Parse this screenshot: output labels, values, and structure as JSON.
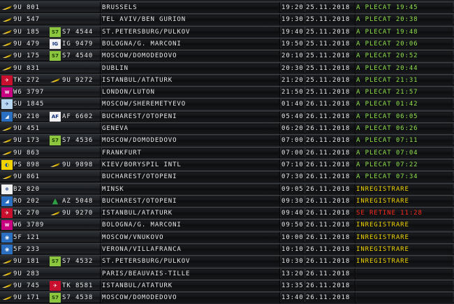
{
  "colors": {
    "green": "#8fe24a",
    "yellow": "#f2d600",
    "red": "#ff2a1a"
  },
  "rows": [
    {
      "logo": "wing",
      "flight": "9U 801",
      "code_logo": "",
      "code": "",
      "dest": "BRUSSELS",
      "time": "19:20",
      "date": "25.11.2018",
      "status": "A PLECAT 19:45",
      "status_type": "green"
    },
    {
      "logo": "wing",
      "flight": "9U 547",
      "code_logo": "",
      "code": "",
      "dest": "TEL AVIV/BEN GURION",
      "time": "19:30",
      "date": "25.11.2018",
      "status": "A PLECAT 20:38",
      "status_type": "green"
    },
    {
      "logo": "wing",
      "flight": "9U 185",
      "code_logo": "s7",
      "code": "S7 4544",
      "dest": "ST.PETERSBURG/PULKOV",
      "time": "19:40",
      "date": "25.11.2018",
      "status": "A PLECAT 19:48",
      "status_type": "green"
    },
    {
      "logo": "wing",
      "flight": "9U 479",
      "code_logo": "alitalia",
      "code": "IG 9479",
      "dest": "BOLOGNA/G. MARCONI",
      "time": "19:50",
      "date": "25.11.2018",
      "status": "A PLECAT 20:06",
      "status_type": "green"
    },
    {
      "logo": "wing",
      "flight": "9U 175",
      "code_logo": "s7",
      "code": "S7 4540",
      "dest": "MOSCOW/DOMODEDOVO",
      "time": "20:10",
      "date": "25.11.2018",
      "status": "A PLECAT 20:52",
      "status_type": "green"
    },
    {
      "logo": "wing",
      "flight": "9U 831",
      "code_logo": "",
      "code": "",
      "dest": "DUBLIN",
      "time": "20:30",
      "date": "25.11.2018",
      "status": "A PLECAT 20:44",
      "status_type": "green"
    },
    {
      "logo": "turkish",
      "flight": "TK 272",
      "code_logo": "wing",
      "code": "9U 9272",
      "dest": "ISTANBUL/ATATURK",
      "time": "21:20",
      "date": "25.11.2018",
      "status": "A PLECAT 21:31",
      "status_type": "green"
    },
    {
      "logo": "wizz",
      "flight": "W6 3797",
      "code_logo": "",
      "code": "",
      "dest": "LONDON/LUTON",
      "time": "21:50",
      "date": "25.11.2018",
      "status": "A PLECAT 21:57",
      "status_type": "green"
    },
    {
      "logo": "aeroflot",
      "flight": "SU 1845",
      "code_logo": "",
      "code": "",
      "dest": "MOSCOW/SHEREMETYEVO",
      "time": "01:40",
      "date": "26.11.2018",
      "status": "A PLECAT 01:42",
      "status_type": "green"
    },
    {
      "logo": "tarom",
      "flight": "RO 210",
      "code_logo": "airfrance",
      "code": "AF 6602",
      "dest": "BUCHAREST/OTOPENI",
      "time": "05:40",
      "date": "26.11.2018",
      "status": "A PLECAT 06:05",
      "status_type": "green"
    },
    {
      "logo": "wing",
      "flight": "9U 451",
      "code_logo": "",
      "code": "",
      "dest": "GENEVA",
      "time": "06:20",
      "date": "26.11.2018",
      "status": "A PLECAT 06:26",
      "status_type": "green"
    },
    {
      "logo": "wing",
      "flight": "9U 173",
      "code_logo": "s7",
      "code": "S7 4536",
      "dest": "MOSCOW/DOMODEDOVO",
      "time": "07:00",
      "date": "26.11.2018",
      "status": "A PLECAT 07:11",
      "status_type": "green"
    },
    {
      "logo": "wing",
      "flight": "9U 863",
      "code_logo": "",
      "code": "",
      "dest": "FRANKFURT",
      "time": "07:00",
      "date": "26.11.2018",
      "status": "A PLECAT 07:04",
      "status_type": "green"
    },
    {
      "logo": "ukraine",
      "flight": "PS 898",
      "code_logo": "wing",
      "code": "9U 9898",
      "dest": "KIEV/BORYSPIL INTL",
      "time": "07:10",
      "date": "26.11.2018",
      "status": "A PLECAT 07:22",
      "status_type": "green"
    },
    {
      "logo": "wing",
      "flight": "9U 861",
      "code_logo": "",
      "code": "",
      "dest": "BUCHAREST/OTOPENI",
      "time": "07:30",
      "date": "26.11.2018",
      "status": "A PLECAT 07:34",
      "status_type": "green"
    },
    {
      "logo": "belavia",
      "flight": "B2 820",
      "code_logo": "",
      "code": "",
      "dest": "MINSK",
      "time": "09:05",
      "date": "26.11.2018",
      "status": "INREGISTRARE",
      "status_type": "yellow"
    },
    {
      "logo": "tarom",
      "flight": "RO 202",
      "code_logo": "alitalia-a",
      "code": "AZ 5048",
      "dest": "BUCHAREST/OTOPENI",
      "time": "09:30",
      "date": "26.11.2018",
      "status": "INREGISTRARE",
      "status_type": "yellow"
    },
    {
      "logo": "turkish",
      "flight": "TK 270",
      "code_logo": "wing",
      "code": "9U 9270",
      "dest": "ISTANBUL/ATATURK",
      "time": "09:40",
      "date": "26.11.2018",
      "status": "SE RETINE 11:28",
      "status_type": "red"
    },
    {
      "logo": "wizz",
      "flight": "W6 3789",
      "code_logo": "",
      "code": "",
      "dest": "BOLOGNA/G. MARCONI",
      "time": "09:50",
      "date": "26.11.2018",
      "status": "INREGISTRARE",
      "status_type": "yellow"
    },
    {
      "logo": "pobeda",
      "flight": "5F 121",
      "code_logo": "",
      "code": "",
      "dest": "MOSCOW/VNUKOVO",
      "time": "10:00",
      "date": "26.11.2018",
      "status": "INREGISTRARE",
      "status_type": "yellow"
    },
    {
      "logo": "pobeda",
      "flight": "5F 233",
      "code_logo": "",
      "code": "",
      "dest": "VERONA/VILLAFRANCA",
      "time": "10:10",
      "date": "26.11.2018",
      "status": "INREGISTRARE",
      "status_type": "yellow"
    },
    {
      "logo": "wing",
      "flight": "9U 181",
      "code_logo": "s7",
      "code": "S7 4532",
      "dest": "ST.PETERSBURG/PULKOV",
      "time": "10:30",
      "date": "26.11.2018",
      "status": "INREGISTRARE",
      "status_type": "yellow"
    },
    {
      "logo": "wing",
      "flight": "9U 283",
      "code_logo": "",
      "code": "",
      "dest": "PARIS/BEAUVAIS-TILLE",
      "time": "13:20",
      "date": "26.11.2018",
      "status": "",
      "status_type": "none"
    },
    {
      "logo": "wing",
      "flight": "9U 745",
      "code_logo": "turkish",
      "code": "TK 8581",
      "dest": "ISTANBUL/ATATURK",
      "time": "13:35",
      "date": "26.11.2018",
      "status": "",
      "status_type": "none"
    },
    {
      "logo": "wing",
      "flight": "9U 171",
      "code_logo": "s7",
      "code": "S7 4538",
      "dest": "MOSCOW/DOMODEDOVO",
      "time": "13:40",
      "date": "26.11.2018",
      "status": "",
      "status_type": "none"
    }
  ]
}
